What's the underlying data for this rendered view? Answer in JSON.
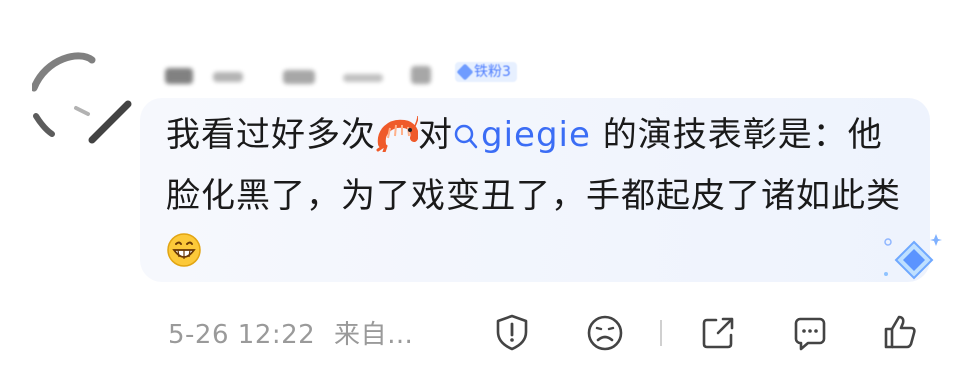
{
  "comment": {
    "badge_text": "铁粉3",
    "content_part1": "我看过好多次",
    "emoji_shrimp": "shrimp-emoji",
    "content_part2": "对",
    "mention": "giegie",
    "content_part3": " 的演技表彰是：他脸化黑了，为了戏变丑了，手都起皮了诸如此类",
    "emoji_grin": "grinning-face-emoji",
    "time": "5-26 12:22",
    "source": "来自…"
  },
  "actions": {
    "icons": [
      "report-icon",
      "dislike-face-icon",
      "share-icon",
      "comment-icon",
      "like-thumb-icon"
    ]
  },
  "colors": {
    "bubble": "#eef3fd",
    "mention": "#3b6df5",
    "meta_text": "#9a9a9a",
    "icon": "#444444"
  }
}
